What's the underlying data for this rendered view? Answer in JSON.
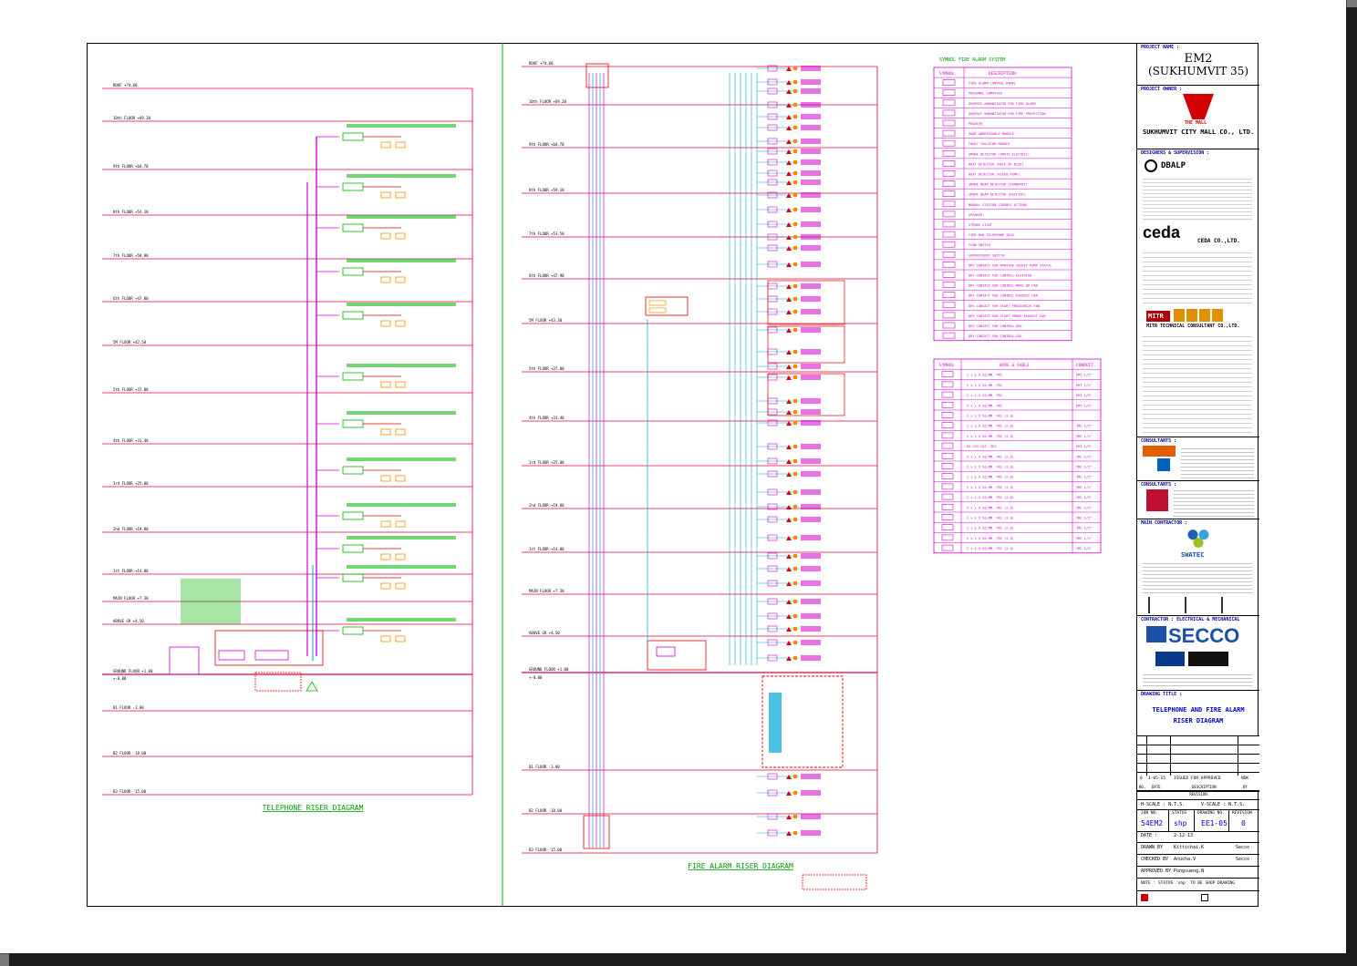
{
  "colors": {
    "floor_line": "#e4003a",
    "green": "#00b400",
    "magenta": "#d400d4",
    "cyan": "#00a6d6",
    "orange": "#ff8a00",
    "red": "#e00000",
    "title_green": "#00a000"
  },
  "telephone": {
    "title": "TELEPHONE RISER DIAGRAM",
    "floors": [
      {
        "name": "ROOF",
        "level": "+74.60"
      },
      {
        "name": "10th FLOOR",
        "level": "+69.20"
      },
      {
        "name": "9th FLOOR",
        "level": "+64.70"
      },
      {
        "name": "8th FLOOR",
        "level": "+54.10"
      },
      {
        "name": "7th FLOOR",
        "level": "+50.80"
      },
      {
        "name": "6th FLOOR",
        "level": "+47.80"
      },
      {
        "name": "5M FLOOR",
        "level": "+42.50"
      },
      {
        "name": "5th FLOOR",
        "level": "+37.00"
      },
      {
        "name": "4th FLOOR",
        "level": "+31.40"
      },
      {
        "name": "3rd FLOOR",
        "level": "+25.80"
      },
      {
        "name": "2nd FLOOR",
        "level": "+19.80"
      },
      {
        "name": "1st FLOOR",
        "level": "+14.00"
      },
      {
        "name": "MAIN FLOOR",
        "level": "+7.30"
      },
      {
        "name": "ABOVE GR",
        "level": "+4.50"
      },
      {
        "name": "GROUND FLOOR",
        "level": "+1.00"
      },
      {
        "name": "",
        "level": "+-0.00"
      },
      {
        "name": "B1 FLOOR",
        "level": "-3.00"
      },
      {
        "name": "B2 FLOOR",
        "level": "-10.00"
      },
      {
        "name": "B3 FLOOR",
        "level": "-15.00"
      }
    ],
    "legend_box_label": "FIRE ALARM CONTROL PANEL"
  },
  "fire_alarm": {
    "title": "FIRE ALARM RISER DIAGRAM",
    "floors": [
      {
        "name": "ROOF",
        "level": "+74.60"
      },
      {
        "name": "10th FLOOR",
        "level": "+69.20"
      },
      {
        "name": "9th FLOOR",
        "level": "+64.70"
      },
      {
        "name": "8th FLOOR",
        "level": "+59.10"
      },
      {
        "name": "7th FLOOR",
        "level": "+53.50"
      },
      {
        "name": "6th FLOOR",
        "level": "+47.90"
      },
      {
        "name": "5M FLOOR",
        "level": "+43.30"
      },
      {
        "name": "5th FLOOR",
        "level": "+37.00"
      },
      {
        "name": "4th FLOOR",
        "level": "+31.40"
      },
      {
        "name": "3rd FLOOR",
        "level": "+25.80"
      },
      {
        "name": "2nd FLOOR",
        "level": "+19.80"
      },
      {
        "name": "1st FLOOR",
        "level": "+14.00"
      },
      {
        "name": "MAIN FLOOR",
        "level": "+7.30"
      },
      {
        "name": "ABOVE GR",
        "level": "+4.50"
      },
      {
        "name": "GROUND FLOOR",
        "level": "+1.00"
      },
      {
        "name": "",
        "level": "+-0.00"
      },
      {
        "name": "B1 FLOOR",
        "level": "-3.00"
      },
      {
        "name": "B2 FLOOR",
        "level": "-10.00"
      },
      {
        "name": "B3 FLOOR",
        "level": "-15.00"
      }
    ]
  },
  "legend": {
    "title": "SYMBOL FIRE ALARM SYSTEM",
    "symbol_header": "SYMBOL",
    "desc_header": "DESCRIPTION",
    "items": [
      "FIRE ALARM CONTROL PANEL",
      "PERSONAL COMPUTER",
      "GRAPHIC ANNUNCIATOR FOR FIRE ALARM",
      "GRAPHIC ANNUNCIATOR FOR FIRE PROTECTION",
      "PRINTER",
      "ZONE ADDRESSABLE MODULE",
      "FAULT ISOLATOR MODULE",
      "SMOKE DETECTOR (PHOTO ELECTRIC)",
      "HEAT DETECTOR (RATE OF RISE)",
      "HEAT DETECTOR (FIXED TEMP)",
      "SMOKE BEAM DETECTOR (TRANSMIT)",
      "SMOKE BEAM DETECTOR (RECEIVE)",
      "MANUAL STATION (DOUBLE ACTION)",
      "SPEAKER",
      "STROBE LIGHT",
      "FIRE MAN TELEPHONE JACK",
      "FLOW SWITCH",
      "SUPERVISORY SWITCH",
      "DRY CONTACT FOR MONITOR JOCKEY PUMP STATUS",
      "DRY CONTACT FOR CONTROL ELEVATOR",
      "DRY CONTACT FOR CONTROL MAKE UP FAN",
      "DRY CONTACT FOR CONTROL EXHAUST FAN",
      "DRY CONTACT FOR START PRESSURIZE FAN",
      "DRY CONTACT FOR START SMOKE EXHAUST FAN",
      "DRY CONTACT FOR CONTROL AHU",
      "DRY CONTACT FOR CONTROL CAU"
    ],
    "wire_header": "WIRE & CABLE",
    "conduit_header": "CONDUIT",
    "wires": [
      {
        "desc": "2 x 1.5 SQ.MM. FRC",
        "conduit": "EMT 1/2\""
      },
      {
        "desc": "2 x 1.5 SQ.MM. FRC",
        "conduit": "EMT 1/2\""
      },
      {
        "desc": "2 x 1.5 SQ.MM. FRC",
        "conduit": "EMT 1/2\""
      },
      {
        "desc": "2 x 1.5 SQ.MM. FRC",
        "conduit": "EMT 1/2\""
      },
      {
        "desc": "2 x 2.5 SQ.MM. FRC (2.0)",
        "conduit": ""
      },
      {
        "desc": "2 x 2.5 SQ.MM. FRC (2.0)",
        "conduit": "IMC 1/2\""
      },
      {
        "desc": "2 x 1.5 SQ.MM. FRC (2.0)",
        "conduit": "IMC 1/2\""
      },
      {
        "desc": "RS-232 CAT. 5EV",
        "conduit": "EMT 1/2\""
      },
      {
        "desc": "2 x 1.5 SQ.MM. FRC (2.0)",
        "conduit": "IMC 1/2\""
      },
      {
        "desc": "2 x 1.5 SQ.MM. FRC (2.0)",
        "conduit": "IMC 1/2\""
      },
      {
        "desc": "2 x 1.5 SQ.MM. FRC (2.0)",
        "conduit": "IMC 1/2\""
      },
      {
        "desc": "2 x 1.5 SQ.MM. FRC (2.0)",
        "conduit": "IMC 1/2\""
      },
      {
        "desc": "2 x 1.5 SQ.MM. FRC (2.0)",
        "conduit": "IMC 1/2\""
      },
      {
        "desc": "2 x 1.5 SQ.MM. FRC (2.0)",
        "conduit": "IMC 1/2\""
      },
      {
        "desc": "2 x 1.5 SQ.MM. FRC (2.0)",
        "conduit": "IMC 1/2\""
      },
      {
        "desc": "2 x 1.5 SQ.MM. FRC (2.0)",
        "conduit": "IMC 1/2\""
      },
      {
        "desc": "2 x 1.5 SQ.MM. FRC (2.0)",
        "conduit": "IMC 1/2\""
      },
      {
        "desc": "2 x 1.5 SQ.MM. FRC (2.0)",
        "conduit": "IMC 1/2\""
      }
    ]
  },
  "titleblock": {
    "project_name_label": "PROJECT NAME :",
    "project_name": "EM2",
    "project_sub": "(SUKHUMVIT 35)",
    "project_owner_label": "PROJECT OWNER :",
    "owner": "SUKHUMVIT CITY MALL CO., LTD.",
    "owner_logo_text": "THE MALL",
    "designers_label": "DESIGNERS & SUPERVISION :",
    "architect_logo": "DBALP",
    "ceda_logo": "ceda",
    "ceda_name": "CEDA CO.,LTD.",
    "mitr_logo": "MITR",
    "mitr_name": "MITR TECHNICAL CONSULTANT CO.,LTD.",
    "consultants_label": "CONSULTANTS :",
    "consultants2_label": "CONSULTANTS :",
    "main_contractor_label": "MAIN CONTRACTOR :",
    "swatec": "SWATEC",
    "contractor_label": "CONTRACTOR : ELECTRICAL & MECHANICAL",
    "secco": "SECCO",
    "drawing_title_label": "DRAWING TITLE :",
    "drawing_title_1": "TELEPHONE AND FIRE ALARM",
    "drawing_title_2": "RISER DIAGRAM",
    "rev_row": {
      "no": "0",
      "date": "1-05-15",
      "desc": "ISSUED FOR APPROVED",
      "by": "NOK"
    },
    "rev_header": [
      "NO.",
      "DATE",
      "DESCRIPTION",
      "BY"
    ],
    "revision_label": "REVISION",
    "scale_label": "H-SCALE : N.T.S.",
    "vscale_label": "V-SCALE : N.T.S.",
    "job_no_label": "JOB NO.",
    "job_no": "54EM2",
    "status_label": "STATUS",
    "status": "shp",
    "drawing_no_label": "DRAWING NO.",
    "drawing_no": "EE1-05",
    "revision_no_label": "REVISION",
    "revision_no": "0",
    "date_label": "DATE :",
    "date": "2-12-13",
    "drawn_label": "DRAWN BY",
    "drawn": "Kittichai.K",
    "drawn_co": "Secco",
    "checked_label": "CHECKED BY",
    "checked": "Anucha.V",
    "checked_co": "Secco",
    "approved_label": "APPROVED BY",
    "approved": "Pongsueng.N",
    "note": "NOTE : STATUS 'shp' TO BE SHOP DRAWING"
  }
}
